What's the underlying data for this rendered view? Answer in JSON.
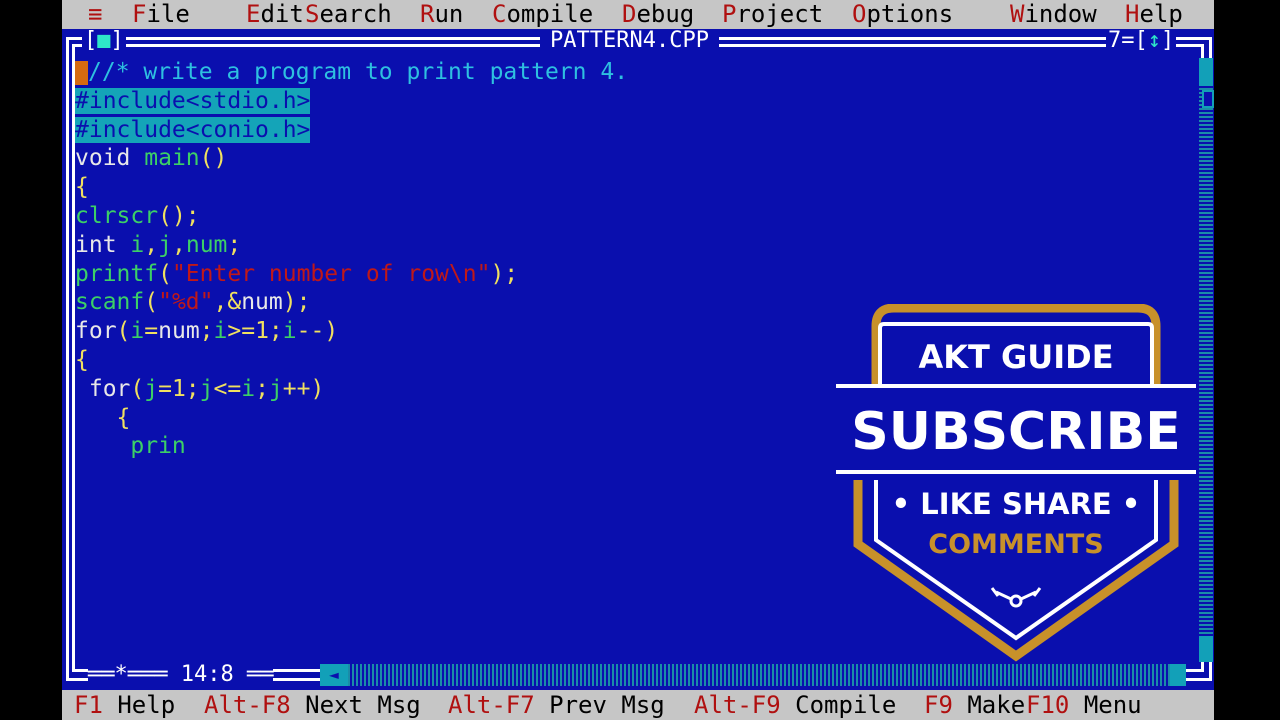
{
  "menubar": {
    "system_glyph": "≡",
    "items": [
      {
        "hot": "F",
        "rest": "ile"
      },
      {
        "hot": "E",
        "rest": "dit"
      },
      {
        "hot": "S",
        "rest": "earch"
      },
      {
        "hot": "R",
        "rest": "un"
      },
      {
        "hot": "C",
        "rest": "ompile"
      },
      {
        "hot": "D",
        "rest": "ebug"
      },
      {
        "hot": "P",
        "rest": "roject"
      },
      {
        "hot": "O",
        "rest": "ptions"
      },
      {
        "hot": "W",
        "rest": "indow"
      },
      {
        "hot": "H",
        "rest": "elp"
      }
    ]
  },
  "window": {
    "title": "PATTERN4.CPP",
    "number": "7",
    "close_glyph": "■",
    "zoom_glyph": "↕",
    "cursor_position": "14:8",
    "modified_glyph": "*"
  },
  "editor": {
    "lines": {
      "l1": "//* write a program to print pattern 4.",
      "l2": "#include<stdio.h>",
      "l3": "#include<conio.h>",
      "l4a": "void",
      "l4b": "main",
      "l4c": "()",
      "l5": "{",
      "l6a": "clrscr",
      "l6b": "();",
      "l7a": "int",
      "l7b": "i",
      "l7c": ",",
      "l7d": "j",
      "l7e": ",",
      "l7f": "num",
      "l7g": ";",
      "l8a": "printf",
      "l8b": "(",
      "l8c": "\"Enter number of row\\n\"",
      "l8d": ");",
      "l9a": "scanf",
      "l9b": "(",
      "l9c": "\"%d\"",
      "l9d": ",&",
      "l9e": "num",
      "l9f": ");",
      "l10a": "for",
      "l10b": "(",
      "l10c": "i",
      "l10d": "=",
      "l10e": "num",
      "l10f": ";",
      "l10g": "i",
      "l10h": ">=1;",
      "l10i": "i",
      "l10j": "--)",
      "l11": "{",
      "l12a": " for",
      "l12b": "(",
      "l12c": "j",
      "l12d": "=1;",
      "l12e": "j",
      "l12f": "<=",
      "l12g": "i",
      "l12h": ";",
      "l12i": "j",
      "l12j": "++)",
      "l13": "   {",
      "l14": "    prin"
    }
  },
  "fkeys": [
    {
      "key": "F1",
      "label": "Help"
    },
    {
      "key": "Alt-F8",
      "label": "Next Msg"
    },
    {
      "key": "Alt-F7",
      "label": "Prev Msg"
    },
    {
      "key": "Alt-F9",
      "label": "Compile"
    },
    {
      "key": "F9",
      "label": "Make"
    },
    {
      "key": "F10",
      "label": "Menu"
    }
  ],
  "badge": {
    "channel": "AKT GUIDE",
    "cta": "SUBSCRIBE",
    "like_share": "• LIKE SHARE •",
    "comments": "COMMENTS",
    "colors": {
      "gold": "#c8912a",
      "white": "#ffffff"
    }
  },
  "colors": {
    "editor_bg": "#0a0fae",
    "menubar_bg": "#c6c6c6",
    "hotkey": "#b01010",
    "identifier": "#3cd066",
    "string": "#c01818",
    "comment": "#2ec0e0"
  }
}
